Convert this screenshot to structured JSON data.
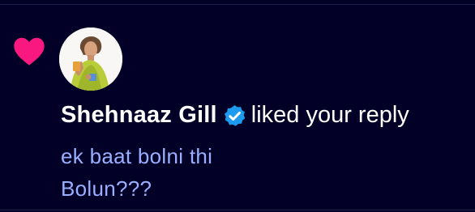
{
  "notification": {
    "icon": "heart-icon",
    "user_name": "Shehnaaz Gill",
    "verified_icon": "verified-badge-icon",
    "action": "liked your reply",
    "reply_lines": [
      "ek baat bolni thi",
      "Bolun???"
    ]
  },
  "colors": {
    "background": "#020026",
    "heart": "#f91880",
    "verified": "#1d9bf0",
    "reply_text": "#9ab0ff",
    "divider": "#1f2250"
  }
}
